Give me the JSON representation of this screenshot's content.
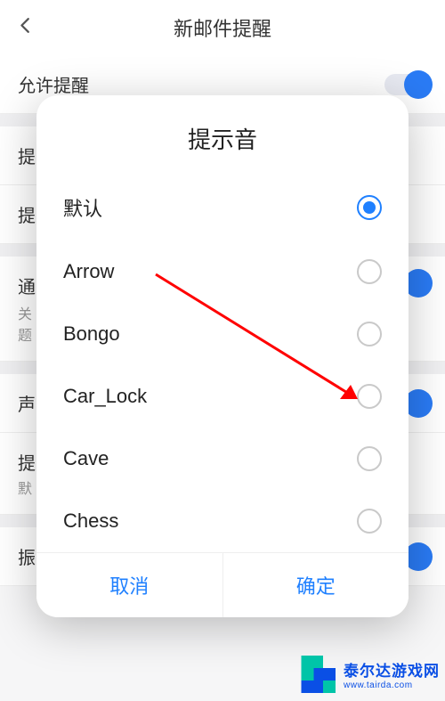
{
  "header": {
    "title": "新邮件提醒"
  },
  "rows": {
    "allow_label": "允许提醒",
    "banner_label": "提",
    "banner2_label": "提",
    "section_title": "通",
    "section_sub": "关\n题",
    "sound_label": "声",
    "tone_title": "提",
    "tone_sub": "默",
    "vibrate_label": "振动"
  },
  "dialog": {
    "title": "提示音",
    "options": [
      {
        "label": "默认",
        "checked": true
      },
      {
        "label": "Arrow",
        "checked": false
      },
      {
        "label": "Bongo",
        "checked": false
      },
      {
        "label": "Car_Lock",
        "checked": false
      },
      {
        "label": "Cave",
        "checked": false
      },
      {
        "label": "Chess",
        "checked": false
      }
    ],
    "cancel": "取消",
    "confirm": "确定"
  },
  "watermark": {
    "text": "泰尔达游戏网",
    "sub": "www.tairda.com"
  }
}
